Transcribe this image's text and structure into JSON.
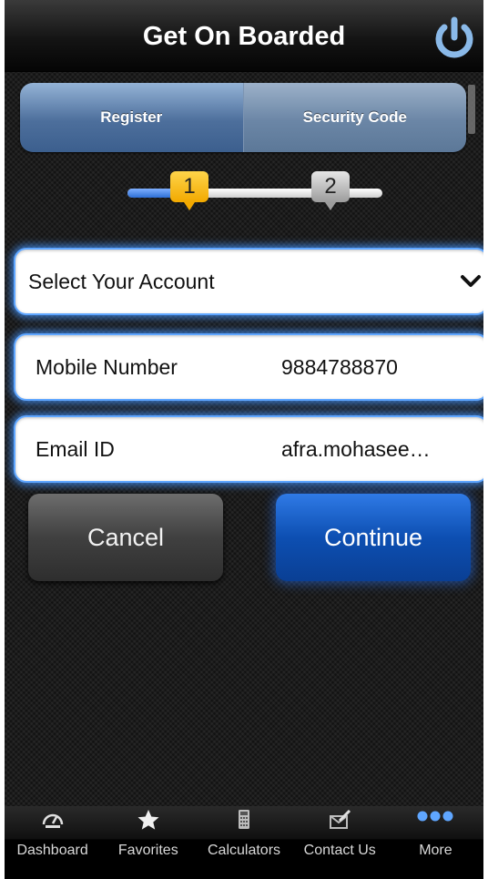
{
  "header": {
    "title": "Get On Boarded"
  },
  "segments": [
    {
      "label": "Register",
      "active": true
    },
    {
      "label": "Security Code",
      "active": false
    }
  ],
  "stepper": {
    "current_step": 1,
    "progress_fraction": 0.22,
    "steps": [
      "1",
      "2"
    ]
  },
  "form": {
    "account_select": {
      "value": "Select Your Account"
    },
    "mobile": {
      "label": "Mobile Number",
      "value": "9884788870"
    },
    "email": {
      "label": "Email ID",
      "value": "afra.mohasee…"
    }
  },
  "buttons": {
    "cancel": "Cancel",
    "continue": "Continue"
  },
  "tabbar": {
    "items": [
      {
        "label": "Dashboard",
        "icon": "speedometer-icon"
      },
      {
        "label": "Favorites",
        "icon": "star-icon"
      },
      {
        "label": "Calculators",
        "icon": "calculator-icon"
      },
      {
        "label": "Contact Us",
        "icon": "envelope-pen-icon"
      },
      {
        "label": "More",
        "icon": "more-dots-icon"
      }
    ]
  },
  "colors": {
    "accent_blue": "#0d4fb2",
    "step_active": "#f2a900",
    "field_glow": "#5fa6ff"
  }
}
